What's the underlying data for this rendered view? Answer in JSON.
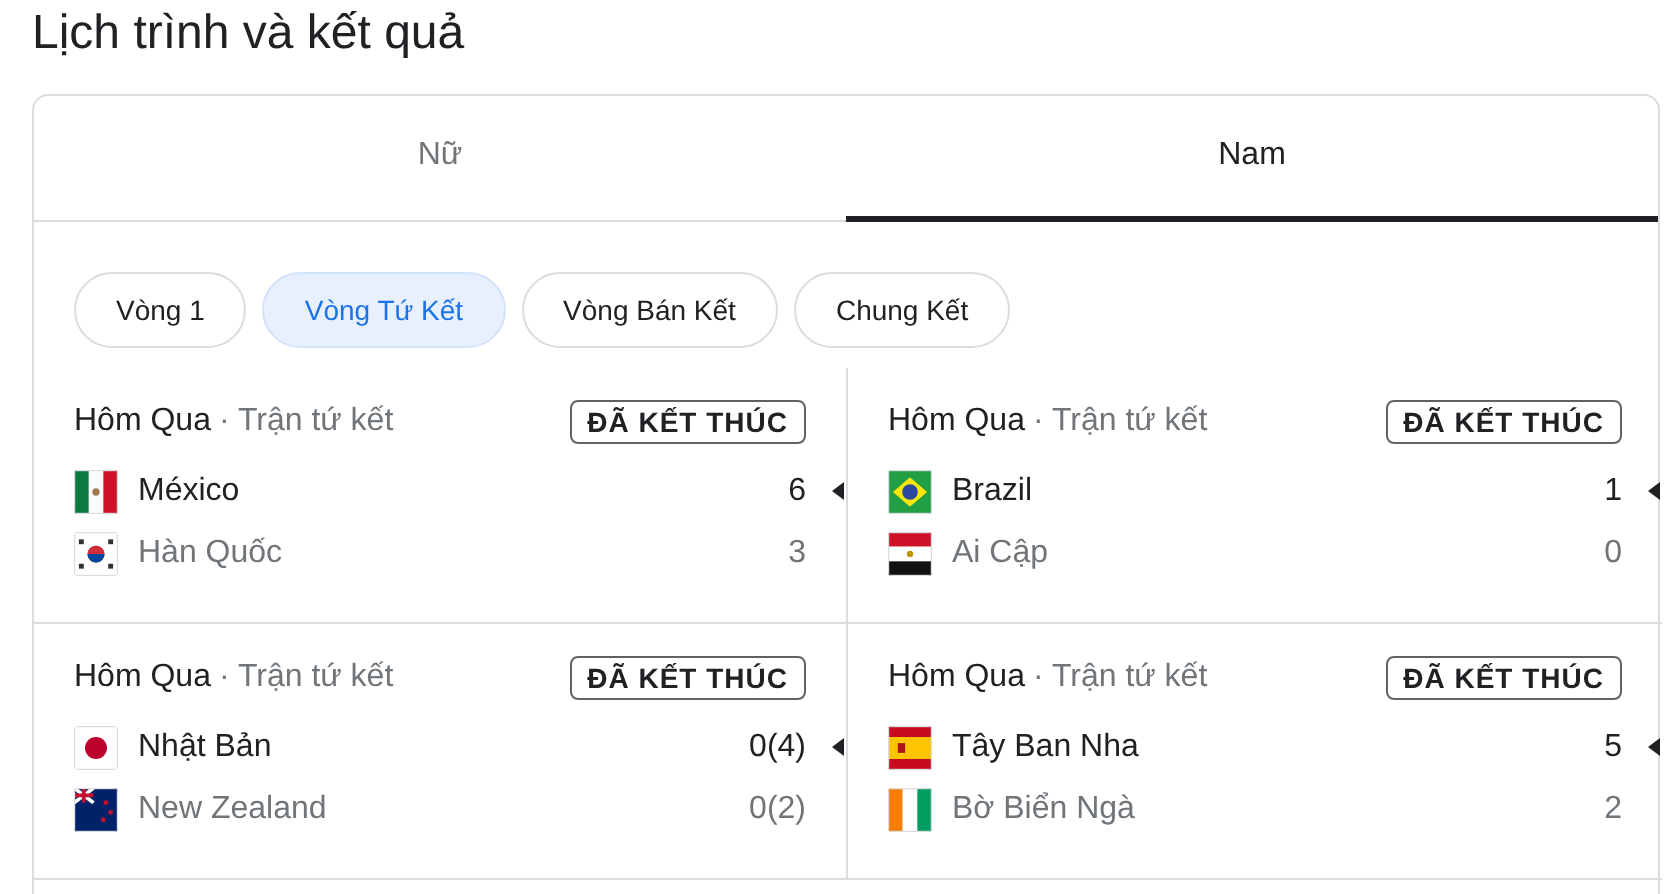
{
  "title": "Lịch trình và kết quả",
  "tabs": [
    {
      "label": "Nữ",
      "selected": false
    },
    {
      "label": "Nam",
      "selected": true
    }
  ],
  "rounds": [
    {
      "label": "Vòng 1",
      "selected": false
    },
    {
      "label": "Vòng Tứ Kết",
      "selected": true
    },
    {
      "label": "Vòng Bán Kết",
      "selected": false
    },
    {
      "label": "Chung Kết",
      "selected": false
    }
  ],
  "matches": [
    {
      "date": "Hôm Qua",
      "stage": "· Trận tứ kết",
      "status": "ĐÃ KẾT THÚC",
      "teams": [
        {
          "kind": "mexico",
          "name": "México",
          "score": "6",
          "winner": true
        },
        {
          "kind": "korea",
          "name": "Hàn Quốc",
          "score": "3",
          "winner": false
        }
      ]
    },
    {
      "date": "Hôm Qua",
      "stage": "· Trận tứ kết",
      "status": "ĐÃ KẾT THÚC",
      "teams": [
        {
          "kind": "brazil",
          "name": "Brazil",
          "score": "1",
          "winner": true
        },
        {
          "kind": "egypt",
          "name": "Ai Cập",
          "score": "0",
          "winner": false
        }
      ]
    },
    {
      "date": "Hôm Qua",
      "stage": "· Trận tứ kết",
      "status": "ĐÃ KẾT THÚC",
      "teams": [
        {
          "kind": "japan",
          "name": "Nhật Bản",
          "score": "0(4)",
          "winner": true
        },
        {
          "kind": "newzealand",
          "name": "New Zealand",
          "score": "0(2)",
          "winner": false
        }
      ]
    },
    {
      "date": "Hôm Qua",
      "stage": "· Trận tứ kết",
      "status": "ĐÃ KẾT THÚC",
      "teams": [
        {
          "kind": "spain",
          "name": "Tây Ban Nha",
          "score": "5",
          "winner": true
        },
        {
          "kind": "ivorycoast",
          "name": "Bờ Biển Ngà",
          "score": "2",
          "winner": false
        }
      ]
    }
  ]
}
